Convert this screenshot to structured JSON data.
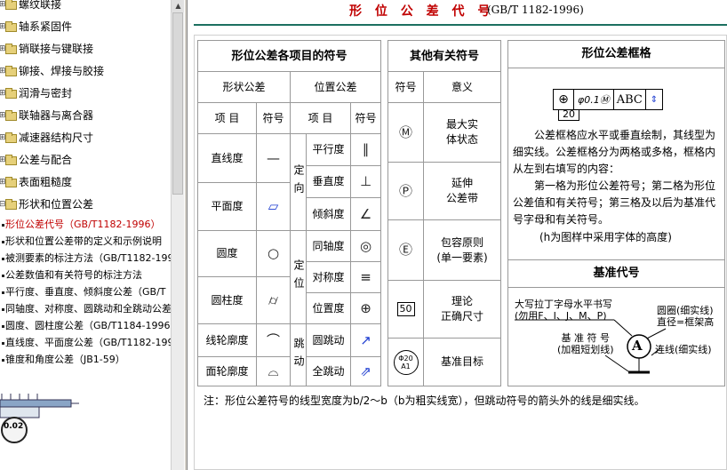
{
  "sidebar": {
    "folders": [
      "螺纹联接",
      "轴系紧固件",
      "销联接与键联接",
      "铆接、焊接与胶接",
      "润滑与密封",
      "联轴器与离合器",
      "减速器结构尺寸",
      "公差与配合",
      "表面粗糙度",
      "形状和位置公差"
    ],
    "leaves": [
      "形位公差代号（GB/T1182-1996）",
      "形状和位置公差带的定义和示例说明",
      "被测要素的标注方法（GB/T1182-1996）",
      "公差数值和有关符号的标注方法",
      "平行度、垂直度、倾斜度公差（GB/T",
      "同轴度、对称度、圆跳动和全跳动公差",
      "圆度、圆柱度公差（GB/T1184-1996）",
      "直线度、平面度公差（GB/T1182-1996）",
      "锥度和角度公差（JB1-59）"
    ],
    "bottom_image_label": "0.02"
  },
  "page": {
    "title": "形 位 公 差 代 号",
    "subtitle": "(GB/T 1182-1996)"
  },
  "table1": {
    "header": "形位公差各项目的符号",
    "group_shape": "形状公差",
    "group_position": "位置公差",
    "col_item": "项  目",
    "col_symbol": "符号",
    "shape_rows": [
      {
        "name": "直线度",
        "symbol": "—"
      },
      {
        "name": "平面度",
        "symbol": "▱"
      },
      {
        "name": "圆度",
        "symbol": "○"
      },
      {
        "name": "圆柱度",
        "symbol": "⌭"
      },
      {
        "name": "线轮廓度",
        "symbol": "⌒"
      },
      {
        "name": "面轮廓度",
        "symbol": "⌓"
      }
    ],
    "position_groups": [
      {
        "label": "定向",
        "rows": [
          {
            "name": "平行度",
            "symbol": "∥"
          },
          {
            "name": "垂直度",
            "symbol": "⊥"
          },
          {
            "name": "倾斜度",
            "symbol": "∠"
          }
        ]
      },
      {
        "label": "定位",
        "rows": [
          {
            "name": "同轴度",
            "symbol": "◎"
          },
          {
            "name": "对称度",
            "symbol": "≡"
          },
          {
            "name": "位置度",
            "symbol": "⊕"
          }
        ]
      },
      {
        "label": "跳动",
        "rows": [
          {
            "name": "圆跳动",
            "symbol": "↗"
          },
          {
            "name": "全跳动",
            "symbol": "⇗"
          }
        ]
      }
    ]
  },
  "table2": {
    "header": "其他有关符号",
    "col_symbol": "符号",
    "col_meaning": "意义",
    "rows": [
      {
        "symbol": "Ⓜ",
        "meaning_1": "最大实",
        "meaning_2": "体状态"
      },
      {
        "symbol": "Ⓟ",
        "meaning_1": "延伸",
        "meaning_2": "公差带"
      },
      {
        "symbol": "Ⓔ",
        "meaning_1": "包容原则",
        "meaning_2": "(单一要素)"
      },
      {
        "symbol": "50",
        "meaning_1": "理论",
        "meaning_2": "正确尺寸"
      },
      {
        "symbol": "Φ20\nA1",
        "meaning_1": "基准目标",
        "meaning_2": ""
      }
    ]
  },
  "frame": {
    "header": "形位公差框格",
    "cell_symbol": "⊕",
    "cell_value": "φ0.1Ⓜ",
    "cell_datum": "ABC",
    "dim_label": "20",
    "para_1": "公差框格应水平或垂直绘制，其线型为细实线。公差框格分为两格或多格，框格内从左到右填写的内容：",
    "para_2": "第一格为形位公差符号；第二格为形位公差值和有关符号；第三格及以后为基准代号字母和有关符号。",
    "para_3": "(h为图样中采用字体的高度)"
  },
  "datum": {
    "header": "基准代号",
    "label_letter_1": "大写拉丁字母水平书写",
    "label_letter_2": "(勿用F、I、J、M、P)",
    "label_circle_1": "圆圈(细实线)",
    "label_circle_2": "直径=框架高",
    "label_symbol_1": "基 准 符 号",
    "label_symbol_2": "(加粗短划线)",
    "label_line": "连线(细实线)",
    "letter": "A"
  },
  "note": "注：形位公差符号的线型宽度为b/2～b（b为粗实线宽），但跳动符号的箭头外的线是细实线。"
}
